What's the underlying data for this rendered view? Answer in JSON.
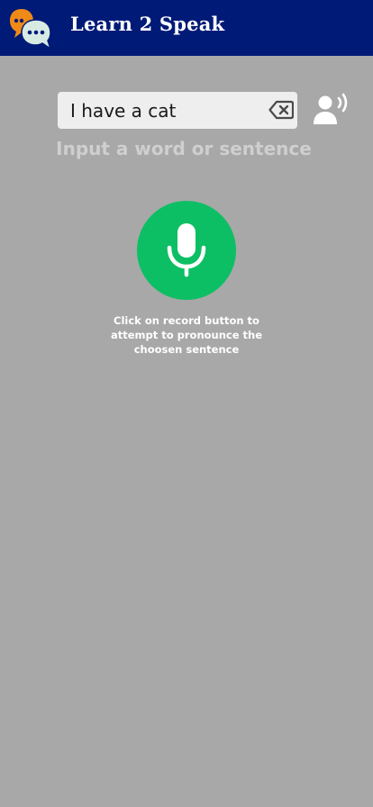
{
  "header": {
    "title": "Learn 2 Speak",
    "logo_icon": "speech-bubbles-logo",
    "background": "#001a77"
  },
  "input": {
    "value": "I have a cat",
    "clear_icon": "backspace-clear-icon"
  },
  "speak_button": {
    "icon": "person-speaking-icon"
  },
  "hint": "Input a word or sentence",
  "record": {
    "icon": "microphone-icon",
    "color": "#0dbf64",
    "instructions": "Click on record button to attempt to pronounce the choosen sentence"
  },
  "colors": {
    "background": "#a8a8a8",
    "logo_orange": "#f08a17",
    "logo_mint": "#d8ebe3"
  }
}
